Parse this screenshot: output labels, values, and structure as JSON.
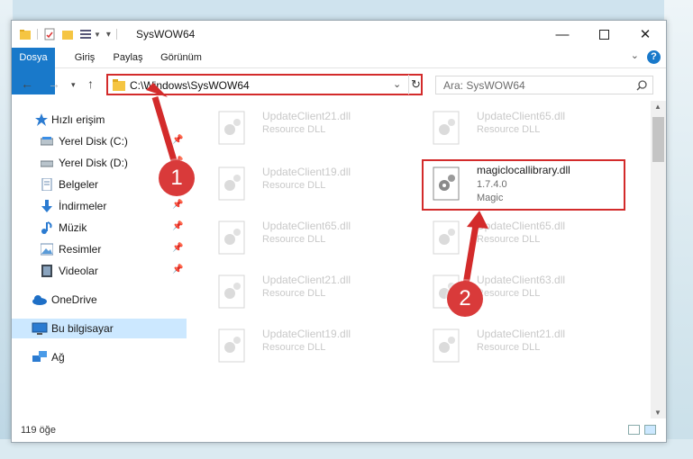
{
  "window": {
    "title": "SysWOW64",
    "controls": [
      "minimize-icon",
      "maximize-icon",
      "close-icon"
    ]
  },
  "ribbon": {
    "tabs": [
      "Dosya",
      "Giriş",
      "Paylaş",
      "Görünüm"
    ],
    "help_label": "?"
  },
  "nav": {
    "address": "C:\\Windows\\SysWOW64",
    "search_placeholder": "Ara: SysWOW64"
  },
  "sidebar": {
    "items": [
      {
        "label": "Hızlı erişim",
        "icon": "star-icon",
        "pinned": false
      },
      {
        "label": "Yerel Disk (C:)",
        "icon": "drive-icon",
        "pinned": true
      },
      {
        "label": "Yerel Disk (D:)",
        "icon": "drive-icon",
        "pinned": true
      },
      {
        "label": "Belgeler",
        "icon": "document-icon",
        "pinned": true
      },
      {
        "label": "İndirmeler",
        "icon": "download-icon",
        "pinned": true
      },
      {
        "label": "Müzik",
        "icon": "music-icon",
        "pinned": true
      },
      {
        "label": "Resimler",
        "icon": "image-icon",
        "pinned": true
      },
      {
        "label": "Videolar",
        "icon": "video-icon",
        "pinned": true
      },
      {
        "label": "OneDrive",
        "icon": "cloud-icon",
        "pinned": false
      },
      {
        "label": "Bu bilgisayar",
        "icon": "computer-icon",
        "pinned": false,
        "selected": true
      },
      {
        "label": "Ağ",
        "icon": "network-icon",
        "pinned": false
      }
    ]
  },
  "files": [
    {
      "name": "UpdateClient21.dll",
      "type": "Resource DLL"
    },
    {
      "name": "UpdateClient65.dll",
      "type": "Resource DLL"
    },
    {
      "name": "UpdateClient19.dll",
      "type": "Resource DLL"
    },
    {
      "name": "magiclocallibrary.dll",
      "version": "1.7.4.0",
      "company": "Magic"
    },
    {
      "name": "UpdateClient65.dll",
      "type": "Resource DLL"
    },
    {
      "name": "UpdateClient65.dll",
      "type": "Resource DLL"
    },
    {
      "name": "UpdateClient21.dll",
      "type": "Resource DLL"
    },
    {
      "name": "UpdateClient63.dll",
      "type": "Resource DLL"
    },
    {
      "name": "UpdateClient19.dll",
      "type": "Resource DLL"
    },
    {
      "name": "UpdateClient21.dll",
      "type": "Resource DLL"
    }
  ],
  "status": {
    "item_count": "119 öğe"
  },
  "annotations": {
    "badge1": "1",
    "badge2": "2",
    "color": "#d32b2b"
  }
}
